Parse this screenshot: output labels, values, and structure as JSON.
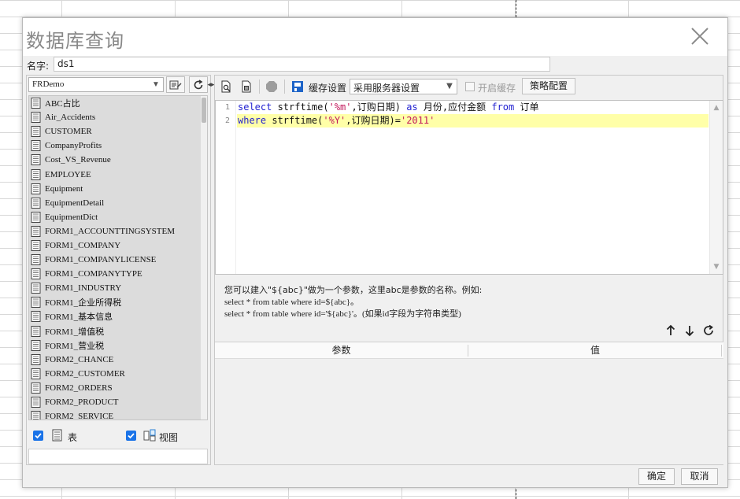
{
  "dialog": {
    "title": "数据库查询",
    "name_label": "名字:",
    "name_value": "ds1",
    "ok_label": "确定",
    "cancel_label": "取消"
  },
  "left": {
    "datasource": "FRDemo",
    "tables": [
      "ABC占比",
      "Air_Accidents",
      "CUSTOMER",
      "CompanyProfits",
      "Cost_VS_Revenue",
      "EMPLOYEE",
      "Equipment",
      "EquipmentDetail",
      "EquipmentDict",
      "FORM1_ACCOUNTTINGSYSTEM",
      "FORM1_COMPANY",
      "FORM1_COMPANYLICENSE",
      "FORM1_COMPANYTYPE",
      "FORM1_INDUSTRY",
      "FORM1_企业所得税",
      "FORM1_基本信息",
      "FORM1_增值税",
      "FORM1_营业税",
      "FORM2_CHANCE",
      "FORM2_CUSTOMER",
      "FORM2_ORDERS",
      "FORM2_PRODUCT",
      "FORM2_SERVICE"
    ],
    "filter_table_label": "表",
    "filter_view_label": "视图"
  },
  "toolbar": {
    "cache_label": "缓存设置",
    "cache_option": "采用服务器设置",
    "enable_cache_label": "开启缓存",
    "policy_label": "策略配置"
  },
  "editor": {
    "line_numbers": [
      "1",
      "2"
    ],
    "line1": {
      "kw1": "select",
      "t1": " strftime(",
      "s1": "'%m'",
      "t2": ",订购日期) ",
      "kw2": "as",
      "t3": " 月份,应付金额 ",
      "kw3": "from",
      "t4": " 订单"
    },
    "line2": {
      "kw1": "where",
      "t1": " strftime(",
      "s1": "'%Y'",
      "t2": ",订购日期)=",
      "s2": "'2011'"
    }
  },
  "hint": {
    "line1": "您可以建入\"${abc}\"做为一个参数，这里abc是参数的名称。例如:",
    "line2": "select * from table where id=${abc}。",
    "line3": "select * from table where id='${abc}'。(如果id字段为字符串类型)"
  },
  "params": {
    "col_param": "参数",
    "col_value": "值"
  },
  "colors": {
    "keyword": "#1f1fd0",
    "string": "#c2185b",
    "active_line": "#ffffa8",
    "checkbox": "#1a73e8"
  }
}
